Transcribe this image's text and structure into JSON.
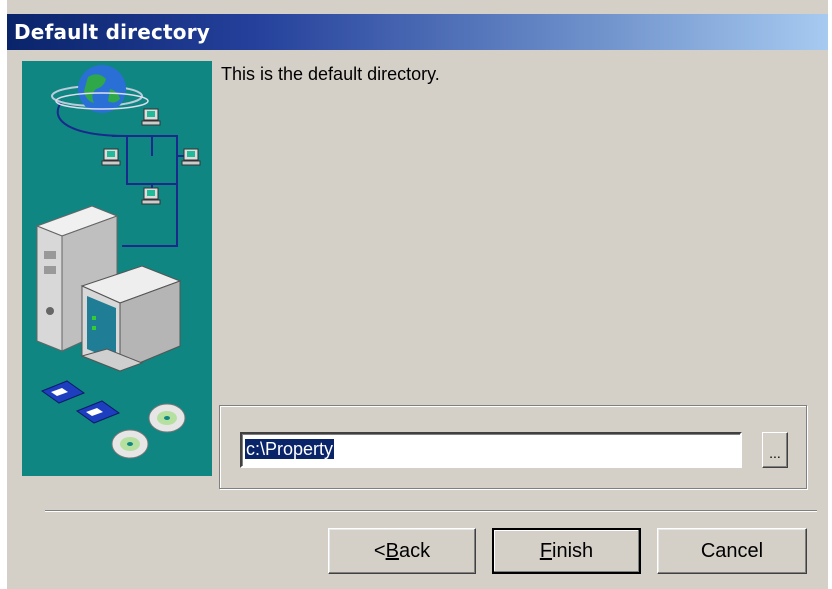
{
  "window": {
    "title": "Default directory"
  },
  "content": {
    "description": "This is the default directory.",
    "directory": {
      "value": "c:\\Property",
      "browse_label": "..."
    }
  },
  "buttons": {
    "back": {
      "mnemonic": "B",
      "rest": "ack",
      "prefix": "<"
    },
    "finish": {
      "mnemonic": "F",
      "rest": "inish"
    },
    "cancel": {
      "label": "Cancel"
    }
  },
  "colors": {
    "titlebar_start": "#0a246a",
    "titlebar_end": "#a6caf0",
    "dialog_bg": "#d4d0c8",
    "image_bg": "#0f8682",
    "selection": "#0a246a"
  }
}
